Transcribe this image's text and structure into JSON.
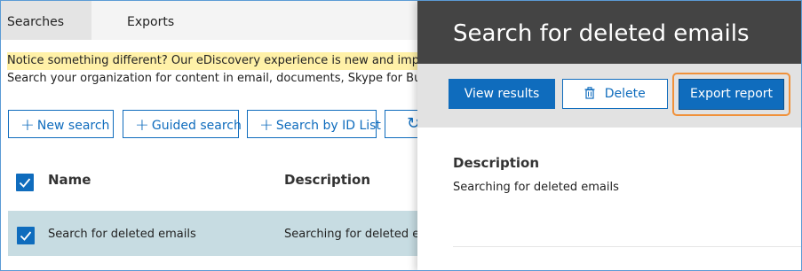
{
  "tabs": [
    {
      "label": "Searches",
      "active": true
    },
    {
      "label": "Exports",
      "active": false
    }
  ],
  "notice": "Notice something different? Our eDiscovery experience is new and improve",
  "intro": "Search your organization for content in email, documents, Skype for Busine",
  "toolbar": {
    "new_search": "New search",
    "guided_search": "Guided search",
    "search_by_id": "Search by ID List",
    "refresh_icon": "refresh-icon"
  },
  "table": {
    "columns": [
      "Name",
      "Description"
    ],
    "header_checked": true,
    "rows": [
      {
        "name": "Search for deleted emails",
        "description": "Searching for deleted em",
        "checked": true
      }
    ]
  },
  "panel": {
    "title": "Search for deleted emails",
    "buttons": {
      "view_results": "View results",
      "delete": "Delete",
      "export_report": "Export report"
    },
    "description_label": "Description",
    "description_text": "Searching for deleted emails"
  },
  "colors": {
    "accent": "#0f6cbd",
    "panel_header": "#444444",
    "notice_bg": "#fff1a8",
    "selected_row": "#c7dce2",
    "highlight_outline": "#f0913a"
  }
}
